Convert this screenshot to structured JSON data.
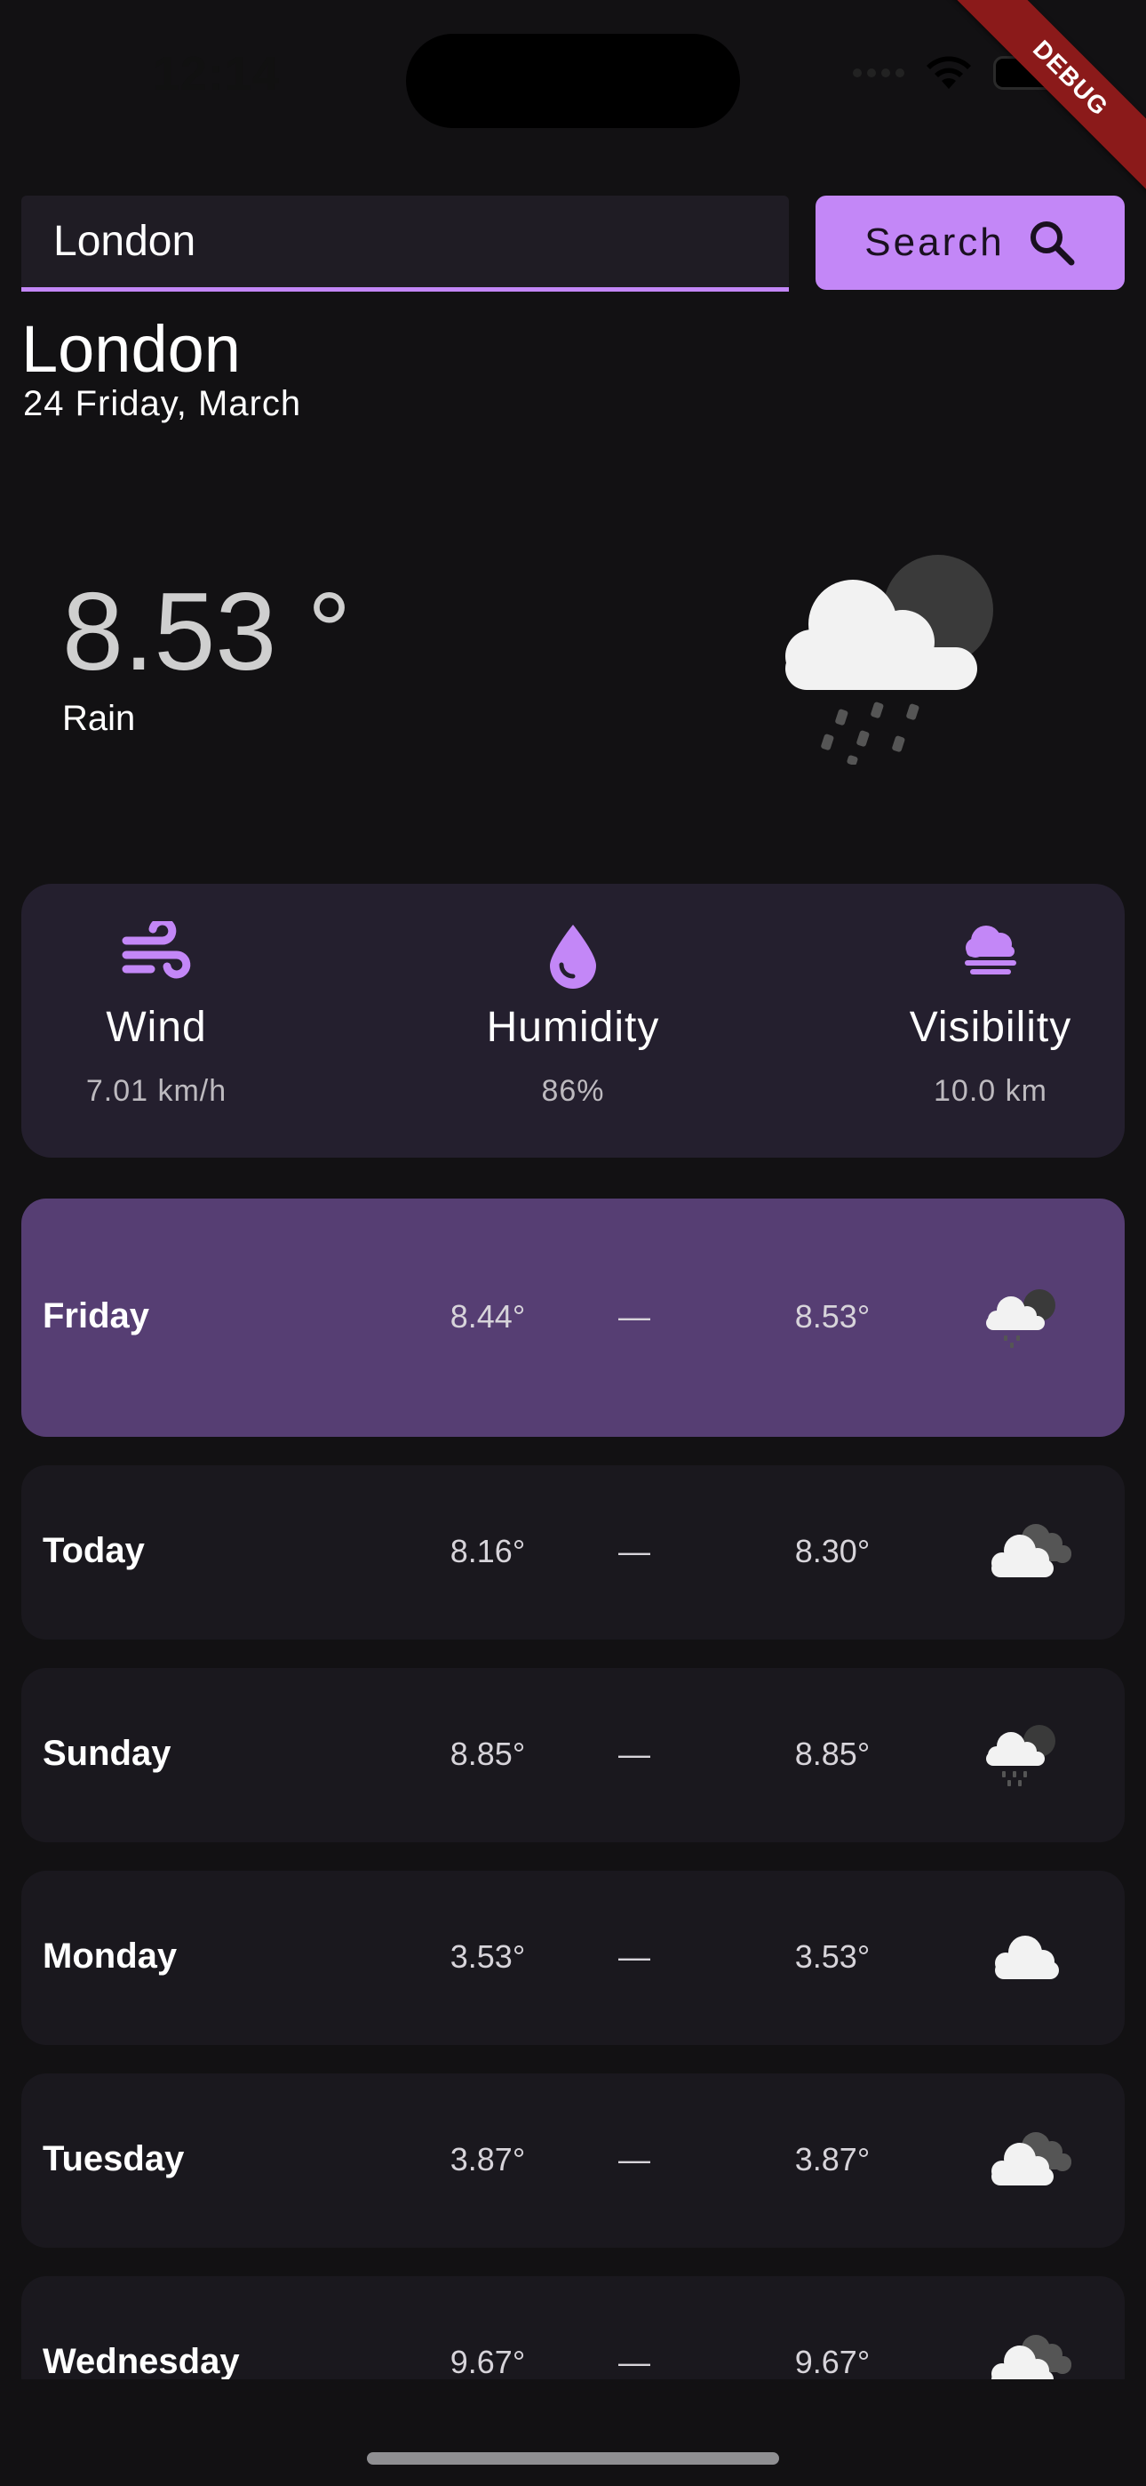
{
  "status_bar": {
    "time": "12:14"
  },
  "debug_label": "DEBUG",
  "search": {
    "value": "London",
    "button_label": "Search"
  },
  "location": {
    "city": "London",
    "date": "24 Friday, March"
  },
  "current": {
    "temperature": "8.53 °",
    "condition": "Rain",
    "icon": "cloud-moon-rain-icon"
  },
  "stats": [
    {
      "icon": "wind-icon",
      "label": "Wind",
      "value": "7.01 km/h"
    },
    {
      "icon": "water-drop-icon",
      "label": "Humidity",
      "value": "86%"
    },
    {
      "icon": "fog-cloud-icon",
      "label": "Visibility",
      "value": "10.0 km"
    }
  ],
  "forecast": [
    {
      "day": "Friday",
      "min": "8.44°",
      "sep": "—",
      "max": "8.53°",
      "icon": "cloud-moon-rain-icon",
      "selected": true
    },
    {
      "day": "Today",
      "min": "8.16°",
      "sep": "—",
      "max": "8.30°",
      "icon": "clouds-icon"
    },
    {
      "day": "Sunday",
      "min": "8.85°",
      "sep": "—",
      "max": "8.85°",
      "icon": "cloud-moon-rain-icon"
    },
    {
      "day": "Monday",
      "min": "3.53°",
      "sep": "—",
      "max": "3.53°",
      "icon": "cloud-icon"
    },
    {
      "day": "Tuesday",
      "min": "3.87°",
      "sep": "—",
      "max": "3.87°",
      "icon": "clouds-icon"
    },
    {
      "day": "Wednesday",
      "min": "9.67°",
      "sep": "—",
      "max": "9.67°",
      "icon": "clouds-icon"
    }
  ],
  "colors": {
    "accent": "#c387f7",
    "background": "#121113",
    "card": "#241f2e",
    "selected_row": "#563e73",
    "row": "#1a181e"
  }
}
